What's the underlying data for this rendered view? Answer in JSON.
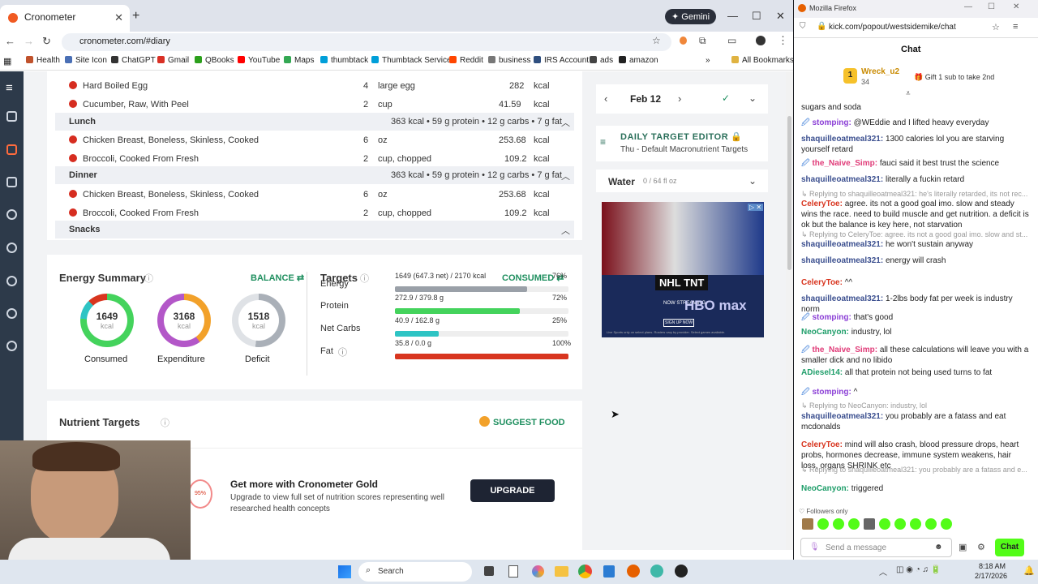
{
  "chrome": {
    "tab_title": "Cronometer",
    "gemini_label": "Gemini",
    "url": "cronometer.com/#diary",
    "bookmarks": [
      "Health",
      "Site Icon",
      "ChatGPT",
      "Gmail",
      "QBooks",
      "YouTube",
      "Maps",
      "thumbtack",
      "Thumbtack Services",
      "Reddit",
      "business",
      "IRS Account",
      "ads",
      "amazon"
    ],
    "all_bookmarks": "All Bookmarks"
  },
  "diary": {
    "rows_top": [
      {
        "name": "Hard Boiled Egg",
        "qty": "4",
        "unit": "large egg",
        "kcal": "282",
        "u": "kcal"
      },
      {
        "name": "Cucumber, Raw, With Peel",
        "qty": "2",
        "unit": "cup",
        "kcal": "41.59",
        "u": "kcal"
      }
    ],
    "lunch": {
      "name": "Lunch",
      "summary": "363 kcal • 59 g protein • 12 g carbs • 7 g fat"
    },
    "rows_lunch": [
      {
        "name": "Chicken Breast, Boneless, Skinless, Cooked",
        "qty": "6",
        "unit": "oz",
        "kcal": "253.68",
        "u": "kcal"
      },
      {
        "name": "Broccoli, Cooked From Fresh",
        "qty": "2",
        "unit": "cup, chopped",
        "kcal": "109.2",
        "u": "kcal"
      }
    ],
    "dinner": {
      "name": "Dinner",
      "summary": "363 kcal • 59 g protein • 12 g carbs • 7 g fat"
    },
    "rows_dinner": [
      {
        "name": "Chicken Breast, Boneless, Skinless, Cooked",
        "qty": "6",
        "unit": "oz",
        "kcal": "253.68",
        "u": "kcal"
      },
      {
        "name": "Broccoli, Cooked From Fresh",
        "qty": "2",
        "unit": "cup, chopped",
        "kcal": "109.2",
        "u": "kcal"
      }
    ],
    "snacks": "Snacks"
  },
  "energy": {
    "title": "Energy Summary",
    "balance": "BALANCE",
    "consumed": {
      "value": "1649",
      "unit": "kcal",
      "label": "Consumed"
    },
    "expenditure": {
      "value": "3168",
      "unit": "kcal",
      "label": "Expenditure"
    },
    "deficit": {
      "value": "1518",
      "unit": "kcal",
      "label": "Deficit"
    }
  },
  "targets": {
    "title": "Targets",
    "consumed_label": "CONSUMED",
    "items": [
      {
        "name": "Energy",
        "value": "1649 (647.3 net) / 2170 kcal",
        "pct": "76%",
        "frac": 0.76,
        "color": "#9aa0a8"
      },
      {
        "name": "Protein",
        "value": "272.9 / 379.8 g",
        "pct": "72%",
        "frac": 0.72,
        "color": "#44d35c"
      },
      {
        "name": "Net Carbs",
        "value": "40.9 / 162.8 g",
        "pct": "25%",
        "frac": 0.25,
        "color": "#2ec4c4"
      },
      {
        "name": "Fat",
        "value": "35.8 / 0.0 g",
        "pct": "100%",
        "frac": 1.0,
        "color": "#d8351f"
      }
    ]
  },
  "nutrient": {
    "title": "Nutrient Targets",
    "suggest": "SUGGEST FOOD"
  },
  "gold": {
    "title": "Get more with Cronometer Gold",
    "body": "Upgrade to view full set of nutrition scores representing well researched health concepts",
    "button": "UPGRADE",
    "badge": "95%"
  },
  "sidebar": {
    "date": "Feb 12",
    "editor_title": "DAILY TARGET EDITOR",
    "editor_sub": "Thu - Default Macronutrient Targets",
    "water_label": "Water",
    "water_value": "0 / 64 fl oz",
    "ad": {
      "brand": "NHL TNT",
      "now": "NOW STREAMING",
      "hbo": "HBO max",
      "signup": "SIGN UP NOW",
      "fine": "Live Sports only on select plans. Rosters vary by provider. Select games available."
    }
  },
  "firefox": {
    "title": "Mozilla Firefox",
    "url": "kick.com/popout/westsidemike/chat",
    "chat_title": "Chat",
    "pinned": {
      "user": "Wreck_u2",
      "count": "34",
      "note": "Gift 1 sub to take 2nd"
    },
    "messages": [
      {
        "user": "",
        "color": "#222",
        "text": "sugars and soda"
      },
      {
        "user": "stomping:",
        "color": "#8b3fd6",
        "text": "@WEddie and I lifted heavy everyday"
      },
      {
        "user": "shaquilleoatmeal321:",
        "color": "#3b4f8f",
        "text": "1300 calories lol you are starving yourself retard"
      },
      {
        "user": "the_Naive_Simp:",
        "color": "#e03b78",
        "text": "fauci said it best trust the science"
      },
      {
        "user": "shaquilleoatmeal321:",
        "color": "#3b4f8f",
        "text": "literally a fuckin retard"
      },
      {
        "reply": "Replying to shaquilleoatmeal321: he's literally retarded, its not rec..."
      },
      {
        "user": "CeleryToe:",
        "color": "#d8351f",
        "text": "agree. its not a good goal imo. slow and steady wins the race. need to build muscle and get nutrition. a deficit is ok but the balance is key here, not starvation"
      },
      {
        "reply": "Replying to CeleryToe: agree. its not a good goal imo. slow and st..."
      },
      {
        "user": "shaquilleoatmeal321:",
        "color": "#3b4f8f",
        "text": "he won't sustain anyway"
      },
      {
        "user": "shaquilleoatmeal321:",
        "color": "#3b4f8f",
        "text": "energy will crash"
      },
      {
        "user": "CeleryToe:",
        "color": "#d8351f",
        "text": "^^"
      },
      {
        "user": "shaquilleoatmeal321:",
        "color": "#3b4f8f",
        "text": "1-2lbs body fat per week is industry norm"
      },
      {
        "user": "stomping:",
        "color": "#8b3fd6",
        "text": "that's good"
      },
      {
        "user": "NeoCanyon:",
        "color": "#1f9e6a",
        "text": "industry, lol"
      },
      {
        "user": "the_Naive_Simp:",
        "color": "#e03b78",
        "text": "all these calculations will leave you with a smaller dick and no libido"
      },
      {
        "user": "ADiesel14:",
        "color": "#1f9e6a",
        "text": "all that protein not being used turns to fat"
      },
      {
        "user": "stomping:",
        "color": "#8b3fd6",
        "text": "^"
      },
      {
        "reply": "Replying to NeoCanyon: industry, lol"
      },
      {
        "user": "shaquilleoatmeal321:",
        "color": "#3b4f8f",
        "text": "you probably are a fatass and eat mcdonalds"
      },
      {
        "user": "CeleryToe:",
        "color": "#d8351f",
        "text": "mind will also crash, blood pressure drops, heart probs, hormones decrease, immune system weakens, hair loss, organs SHRINK etc"
      },
      {
        "reply": "Replying to shaquilleoatmeal321: you probably are a fatass and e..."
      },
      {
        "user": "NeoCanyon:",
        "color": "#1f9e6a",
        "text": "triggered"
      }
    ],
    "followers_only": "Followers only",
    "send_placeholder": "Send a message",
    "chat_button": "Chat"
  },
  "taskbar": {
    "search": "Search",
    "time": "8:18 AM",
    "date": "2/17/2026"
  }
}
